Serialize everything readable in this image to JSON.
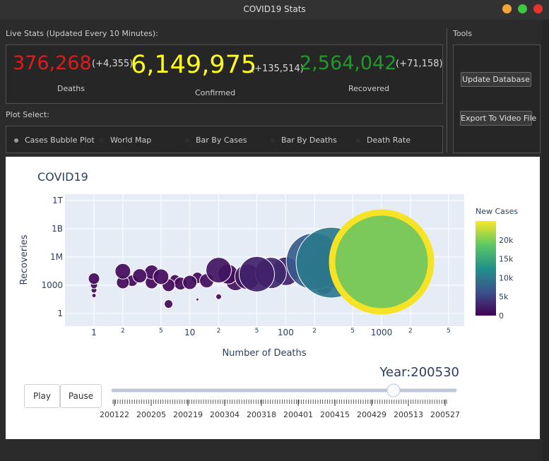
{
  "window": {
    "title": "COVID19 Stats"
  },
  "live_stats": {
    "label": "Live Stats (Updated Every 10 Minutes):",
    "deaths": {
      "value": "376,268",
      "delta": "(+4,355)",
      "caption": "Deaths",
      "color": "#e01b1b"
    },
    "confirmed": {
      "value": "6,149,975",
      "delta": "(+135,514)",
      "caption": "Confirmed",
      "color": "#ffff1e"
    },
    "recovered": {
      "value": "2,564,042",
      "delta": "(+71,158)",
      "caption": "Recovered",
      "color": "#1f9a2a"
    }
  },
  "plot_select": {
    "label": "Plot Select:",
    "options": [
      {
        "label": "Cases Bubble Plot",
        "selected": true
      },
      {
        "label": "World Map",
        "selected": false
      },
      {
        "label": "Bar By Cases",
        "selected": false
      },
      {
        "label": "Bar By Deaths",
        "selected": false
      },
      {
        "label": "Death Rate",
        "selected": false
      }
    ]
  },
  "tools": {
    "label": "Tools",
    "update_button": "Update Database",
    "export_button": "Export To Video File"
  },
  "chart_data": {
    "type": "scatter",
    "title": "COVID19",
    "xlabel": "Number of Deaths",
    "ylabel": "Recoveries",
    "x_scale": "log",
    "y_scale": "log",
    "x_ticks": [
      "1",
      "2",
      "5",
      "10",
      "2",
      "5",
      "100",
      "2",
      "5",
      "1000",
      "2",
      "5"
    ],
    "y_ticks": [
      "1T",
      "1B",
      "1M",
      "1000",
      "1"
    ],
    "colorbar": {
      "title": "New Cases",
      "ticks": [
        "20k",
        "15k",
        "10k",
        "5k",
        "0"
      ],
      "range": [
        0,
        25000
      ],
      "colorscale": "viridis"
    },
    "series": [
      {
        "points": [
          {
            "deaths": 1000,
            "recoveries": 300000,
            "size": 70,
            "new_cases": 25000
          },
          {
            "deaths": 300,
            "recoveries": 250000,
            "size": 50,
            "new_cases": 10000
          },
          {
            "deaths": 200,
            "recoveries": 350000,
            "size": 40,
            "new_cases": 7000
          },
          {
            "deaths": 300,
            "recoveries": 100000,
            "size": 30,
            "new_cases": 6000
          },
          {
            "deaths": 250,
            "recoveries": 800,
            "size": 12,
            "new_cases": 1500
          },
          {
            "deaths": 200,
            "recoveries": 50000,
            "size": 14,
            "new_cases": 3000
          },
          {
            "deaths": 100,
            "recoveries": 30000,
            "size": 20,
            "new_cases": 2500
          },
          {
            "deaths": 70,
            "recoveries": 20000,
            "size": 22,
            "new_cases": 3000
          },
          {
            "deaths": 50,
            "recoveries": 15000,
            "size": 25,
            "new_cases": 2500
          },
          {
            "deaths": 40,
            "recoveries": 8000,
            "size": 18,
            "new_cases": 1500
          },
          {
            "deaths": 30,
            "recoveries": 3000,
            "size": 14,
            "new_cases": 1200
          },
          {
            "deaths": 20,
            "recoveries": 40000,
            "size": 18,
            "new_cases": 1500
          },
          {
            "deaths": 25,
            "recoveries": 15000,
            "size": 14,
            "new_cases": 1000
          },
          {
            "deaths": 15,
            "recoveries": 3000,
            "size": 10,
            "new_cases": 900
          },
          {
            "deaths": 12,
            "recoveries": 6000,
            "size": 8,
            "new_cases": 700
          },
          {
            "deaths": 10,
            "recoveries": 2000,
            "size": 10,
            "new_cases": 800
          },
          {
            "deaths": 8,
            "recoveries": 1500,
            "size": 9,
            "new_cases": 600
          },
          {
            "deaths": 7,
            "recoveries": 4000,
            "size": 7,
            "new_cases": 500
          },
          {
            "deaths": 6,
            "recoveries": 1000,
            "size": 9,
            "new_cases": 500
          },
          {
            "deaths": 5,
            "recoveries": 8000,
            "size": 11,
            "new_cases": 800
          },
          {
            "deaths": 4,
            "recoveries": 25000,
            "size": 10,
            "new_cases": 600
          },
          {
            "deaths": 4,
            "recoveries": 2000,
            "size": 9,
            "new_cases": 500
          },
          {
            "deaths": 3,
            "recoveries": 10000,
            "size": 10,
            "new_cases": 600
          },
          {
            "deaths": 2.5,
            "recoveries": 3000,
            "size": 8,
            "new_cases": 500
          },
          {
            "deaths": 2,
            "recoveries": 30000,
            "size": 11,
            "new_cases": 700
          },
          {
            "deaths": 2,
            "recoveries": 2000,
            "size": 9,
            "new_cases": 600
          },
          {
            "deaths": 1,
            "recoveries": 5000,
            "size": 8,
            "new_cases": 500
          },
          {
            "deaths": 1,
            "recoveries": 1000,
            "size": 5,
            "new_cases": 300
          },
          {
            "deaths": 1,
            "recoveries": 300,
            "size": 4,
            "new_cases": 300
          },
          {
            "deaths": 1,
            "recoveries": 80,
            "size": 3,
            "new_cases": 200
          },
          {
            "deaths": 6,
            "recoveries": 10,
            "size": 6,
            "new_cases": 400
          },
          {
            "deaths": 20,
            "recoveries": 60,
            "size": 4,
            "new_cases": 300
          },
          {
            "deaths": 12,
            "recoveries": 30,
            "size": 2,
            "new_cases": 100
          }
        ]
      }
    ],
    "annotation": "Year:200530",
    "slider": {
      "ticks": [
        "200122",
        "200205",
        "200219",
        "200304",
        "200318",
        "200401",
        "200415",
        "200429",
        "200513",
        "200527"
      ],
      "position": 0.82
    }
  },
  "controls": {
    "play": "Play",
    "pause": "Pause"
  }
}
